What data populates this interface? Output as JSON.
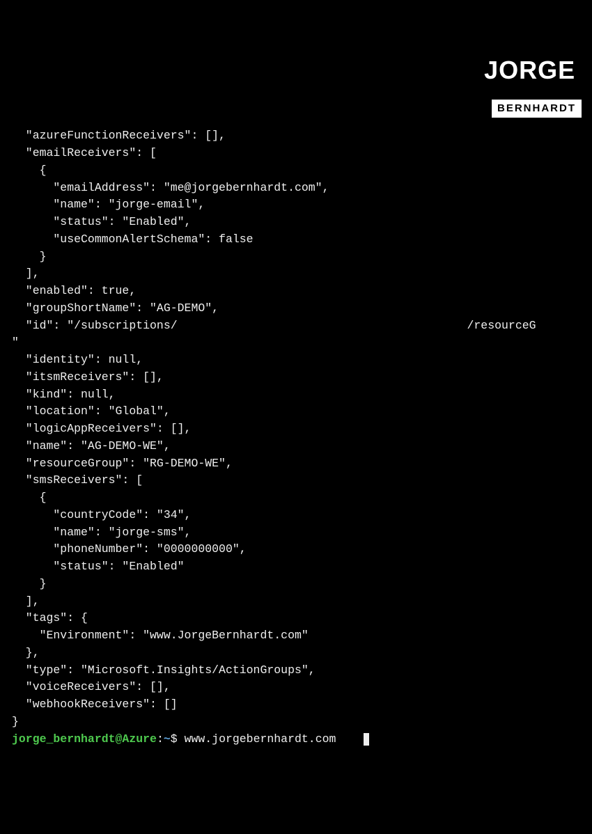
{
  "watermark": {
    "top": "JORGE",
    "bottom": "BERNHARDT"
  },
  "lines": [
    "  \"azureFunctionReceivers\": [],",
    "  \"emailReceivers\": [",
    "    {",
    "      \"emailAddress\": \"me@jorgebernhardt.com\",",
    "      \"name\": \"jorge-email\",",
    "      \"status\": \"Enabled\",",
    "      \"useCommonAlertSchema\": false",
    "    }",
    "  ],",
    "  \"enabled\": true,",
    "  \"groupShortName\": \"AG-DEMO\",",
    "  \"id\": \"/subscriptions/                                          /resourceG",
    "",
    "  \"identity\": null,",
    "  \"itsmReceivers\": [],",
    "  \"kind\": null,",
    "  \"location\": \"Global\",",
    "  \"logicAppReceivers\": [],",
    "  \"name\": \"AG-DEMO-WE\",",
    "  \"resourceGroup\": \"RG-DEMO-WE\",",
    "  \"smsReceivers\": [",
    "    {",
    "      \"countryCode\": \"34\",",
    "      \"name\": \"jorge-sms\",",
    "      \"phoneNumber\": \"0000000000\",",
    "      \"status\": \"Enabled\"",
    "    }",
    "  ],",
    "  \"tags\": {",
    "    \"Environment\": \"www.JorgeBernhardt.com\"",
    "  },",
    "  \"type\": \"Microsoft.Insights/ActionGroups\",",
    "  \"voiceReceivers\": [],",
    "  \"webhookReceivers\": []",
    "}"
  ],
  "wrap_prefix": "\"",
  "prompt": {
    "user": "jorge_bernhardt@Azure",
    "colon": ":",
    "path": "~",
    "dollar": "$",
    "command": "www.jorgebernhardt.com"
  }
}
